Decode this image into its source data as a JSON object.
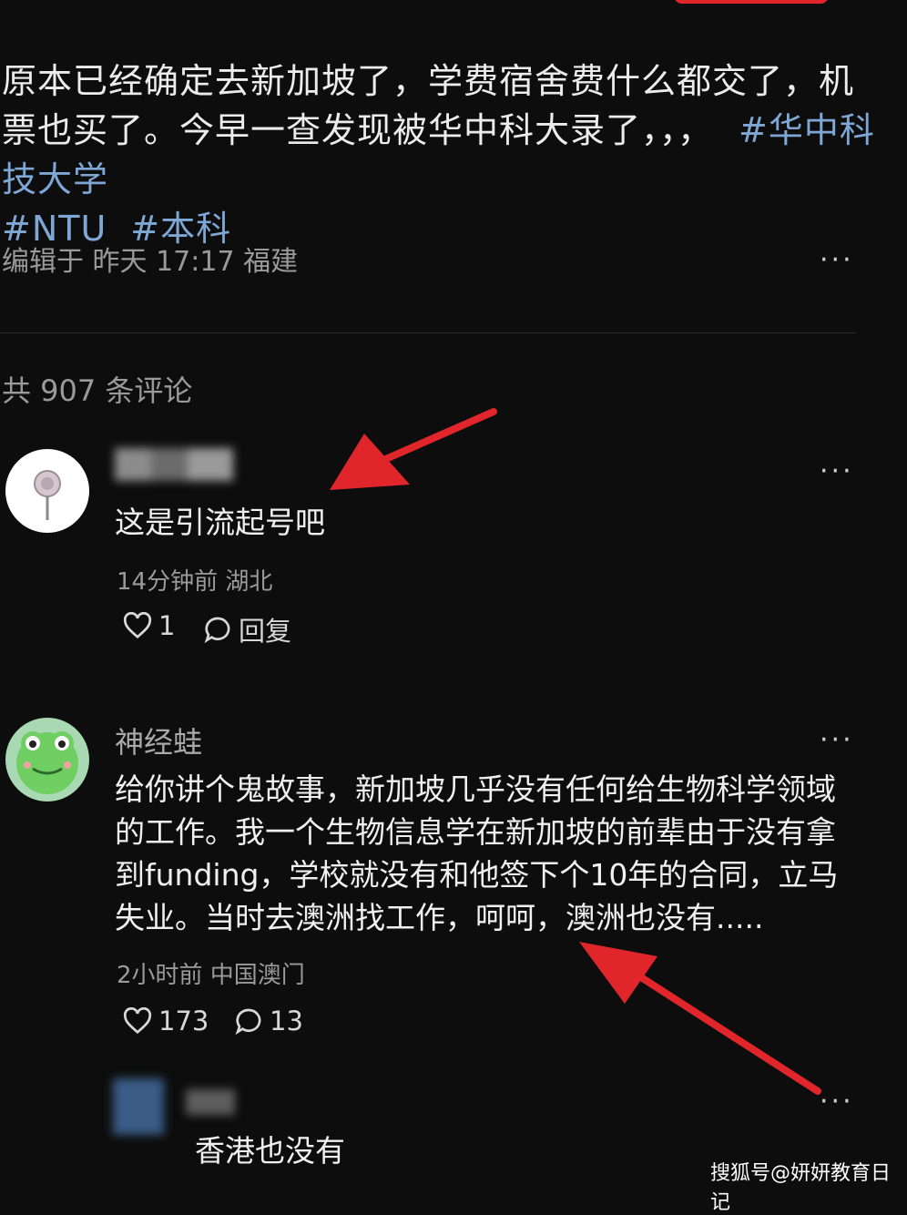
{
  "post": {
    "text": "原本已经确定去新加坡了，学费宿舍费什么都交了，机票也买了。今早一查发现被华中科大录了，，，",
    "tags": [
      "#华中科技大学",
      "#NTU",
      "#本科"
    ],
    "edited": "编辑于 昨天 17:17 福建"
  },
  "comments_header": "共 907 条评论",
  "more_icon_text": "···",
  "comments": [
    {
      "username": "",
      "text": "这是引流起号吧",
      "time_location": "14分钟前 湖北",
      "likes": "1",
      "reply_label": "回复"
    },
    {
      "username": "神经蛙",
      "text": "给你讲个鬼故事，新加坡几乎没有任何给生物科学领域的工作。我一个生物信息学在新加坡的前辈由于没有拿到funding，学校就没有和他签下个10年的合同，立马失业。当时去澳洲找工作，呵呵，澳洲也没有.....",
      "time_location": "2小时前 中国澳门",
      "likes": "173",
      "replies": "13"
    },
    {
      "username": "",
      "text": "香港也没有"
    }
  ],
  "watermark": "搜狐号@妍妍教育日记",
  "colors": {
    "background": "#0d0d0d",
    "tag": "#7fa7d6",
    "arrow": "#e0262b"
  },
  "icons": [
    "heart-icon",
    "comment-icon",
    "more-icon",
    "arrow-annotation"
  ]
}
